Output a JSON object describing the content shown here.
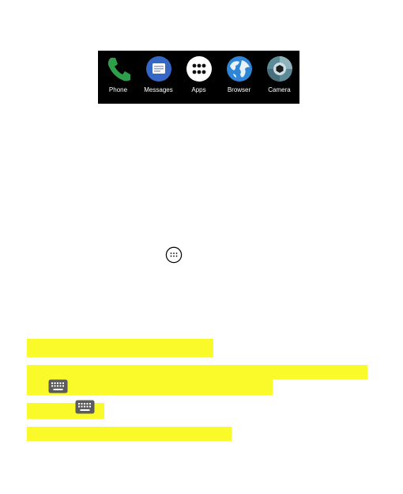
{
  "dock": {
    "apps": [
      {
        "label": "Phone",
        "icon": "phone-icon"
      },
      {
        "label": "Messages",
        "icon": "messages-icon"
      },
      {
        "label": "Apps",
        "icon": "apps-grid-icon"
      },
      {
        "label": "Browser",
        "icon": "browser-globe-icon"
      },
      {
        "label": "Camera",
        "icon": "camera-icon"
      }
    ]
  },
  "inline_icons": [
    "more-options-icon",
    "keyboard-icon",
    "keyboard-icon"
  ],
  "colors": {
    "dock_bg": "#000000",
    "highlight": "#fafa2a",
    "phone_green": "#2e9e4a",
    "messages_blue": "#3568c6",
    "browser_blue": "#2f86d6",
    "camera_teal": "#5d8a97"
  }
}
